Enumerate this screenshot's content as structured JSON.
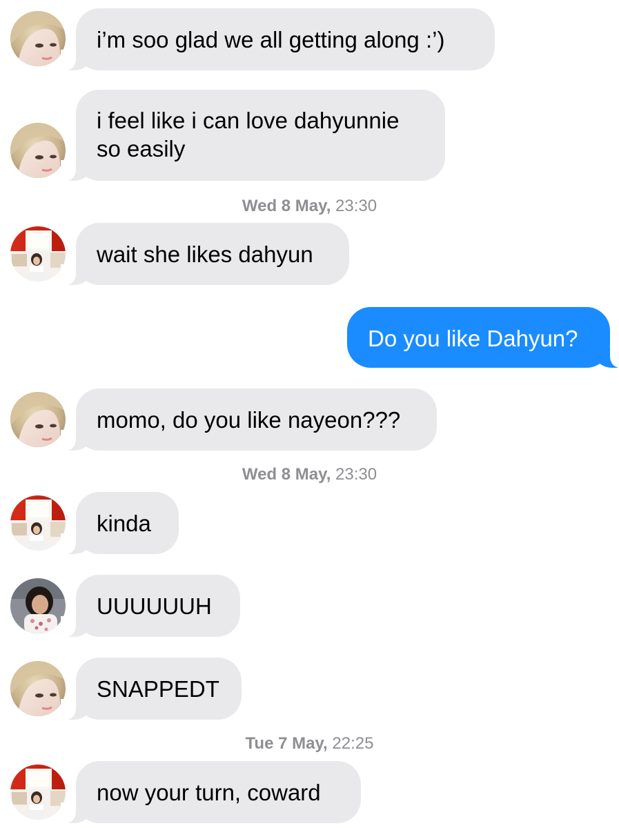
{
  "conversation": {
    "messages": [
      {
        "sender": "blonde-avatar",
        "text": "i’m soo glad we all getting along :’)"
      },
      {
        "sender": "blonde-avatar",
        "line1": "i feel like i can love dahyunnie",
        "line2": "so easily"
      },
      {
        "timestamp_day": "Wed 8 May,",
        "timestamp_time": "23:30"
      },
      {
        "sender": "red-room-avatar",
        "text": "wait she likes dahyun"
      },
      {
        "sender": "me",
        "text": "Do you like Dahyun?"
      },
      {
        "sender": "blonde-avatar",
        "text": "momo, do you like nayeon???"
      },
      {
        "timestamp_day": "Wed 8 May,",
        "timestamp_time": "23:30"
      },
      {
        "sender": "red-room-avatar",
        "text": "kinda"
      },
      {
        "sender": "dark-hair-avatar",
        "text": "UUUUUUH"
      },
      {
        "sender": "blonde-avatar",
        "text": "SNAPPEDT"
      },
      {
        "timestamp_day": "Tue 7 May,",
        "timestamp_time": "22:25"
      },
      {
        "sender": "red-room-avatar",
        "text": "now your turn, coward"
      }
    ]
  },
  "colors": {
    "incoming_bubble": "#e9e9eb",
    "outgoing_bubble": "#1a8cff",
    "timestamp_text": "#8e8e93"
  }
}
